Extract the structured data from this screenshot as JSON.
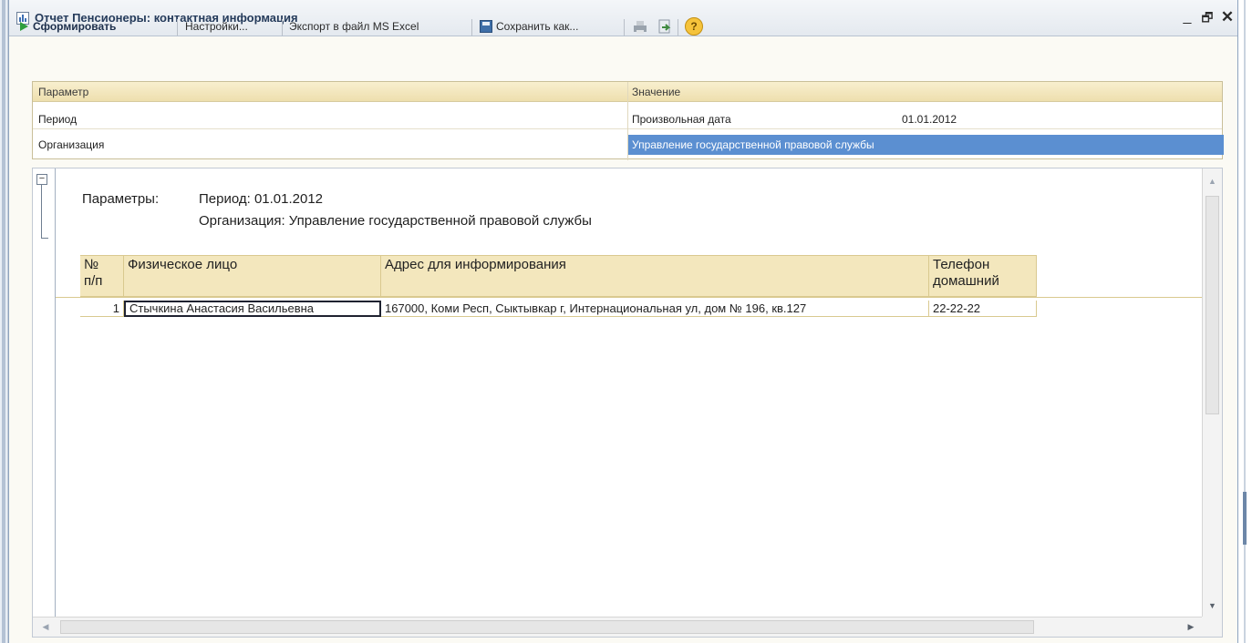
{
  "window": {
    "title": "Отчет  Пенсионеры: контактная информация",
    "minimize_glyph": "_",
    "restore_glyph": "🗗",
    "close_glyph": "✕"
  },
  "toolbar": {
    "generate_label": "Сформировать",
    "settings_label": "Настройки...",
    "export_label": "Экспорт в файл MS Excel",
    "save_as_label": "Сохранить как...",
    "help_glyph": "?"
  },
  "params": {
    "header_param": "Параметр",
    "header_value": "Значение",
    "rows": [
      {
        "name": "Период",
        "value": "Произвольная дата",
        "value2": "01.01.2012"
      },
      {
        "name": "Организация",
        "value": "Управление государственной правовой службы",
        "value2": ""
      }
    ]
  },
  "report": {
    "params_label": "Параметры:",
    "period_line": "Период: 01.01.2012",
    "org_line": "Организация: Управление государственной правовой службы",
    "columns": [
      {
        "line1": "№",
        "line2": "п/п"
      },
      {
        "line1": "Физическое лицо",
        "line2": ""
      },
      {
        "line1": "Адрес для информирования",
        "line2": ""
      },
      {
        "line1": "Телефон",
        "line2": "домашний"
      }
    ],
    "rows": [
      {
        "num": "1",
        "person": "Стычкина Анастасия Васильевна",
        "address": "167000, Коми Респ, Сыктывкар г, Интернациональная ул, дом № 196, кв.127",
        "phone": "22-22-22"
      }
    ]
  },
  "icons": {
    "report_icon": "report-icon",
    "generate_icon": "play-icon",
    "save_icon": "floppy-disk-icon",
    "help_icon": "help-icon"
  },
  "colors": {
    "selection": "#5b8fd1",
    "header_fill": "#f3e7bd",
    "accent_green": "#2f9e3e"
  }
}
